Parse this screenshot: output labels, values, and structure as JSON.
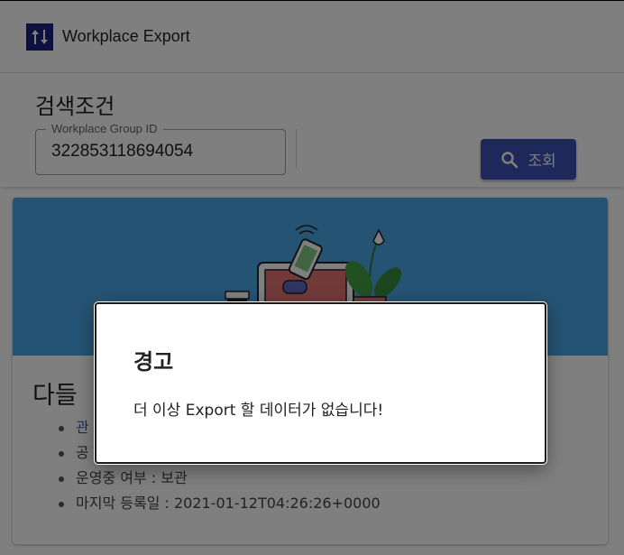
{
  "app": {
    "title": "Workplace Export",
    "logo_icon": "swap-vertical-arrows-icon",
    "logo_color": "#1a237e"
  },
  "search": {
    "title": "검색조건",
    "field_label": "Workplace Group ID",
    "field_value": "322853118694054",
    "button_label": "조회",
    "button_icon": "search-icon",
    "button_color": "#3f51b5"
  },
  "card": {
    "media_color": "#4aa6e6",
    "title": "다들",
    "items": [
      "관",
      "공",
      "운영중 여부 : 보관",
      "마지막 등록일 : 2021-01-12T04:26:26+0000"
    ]
  },
  "dialog": {
    "title": "경고",
    "message": "더 이상 Export 할 데이터가 없습니다!"
  }
}
